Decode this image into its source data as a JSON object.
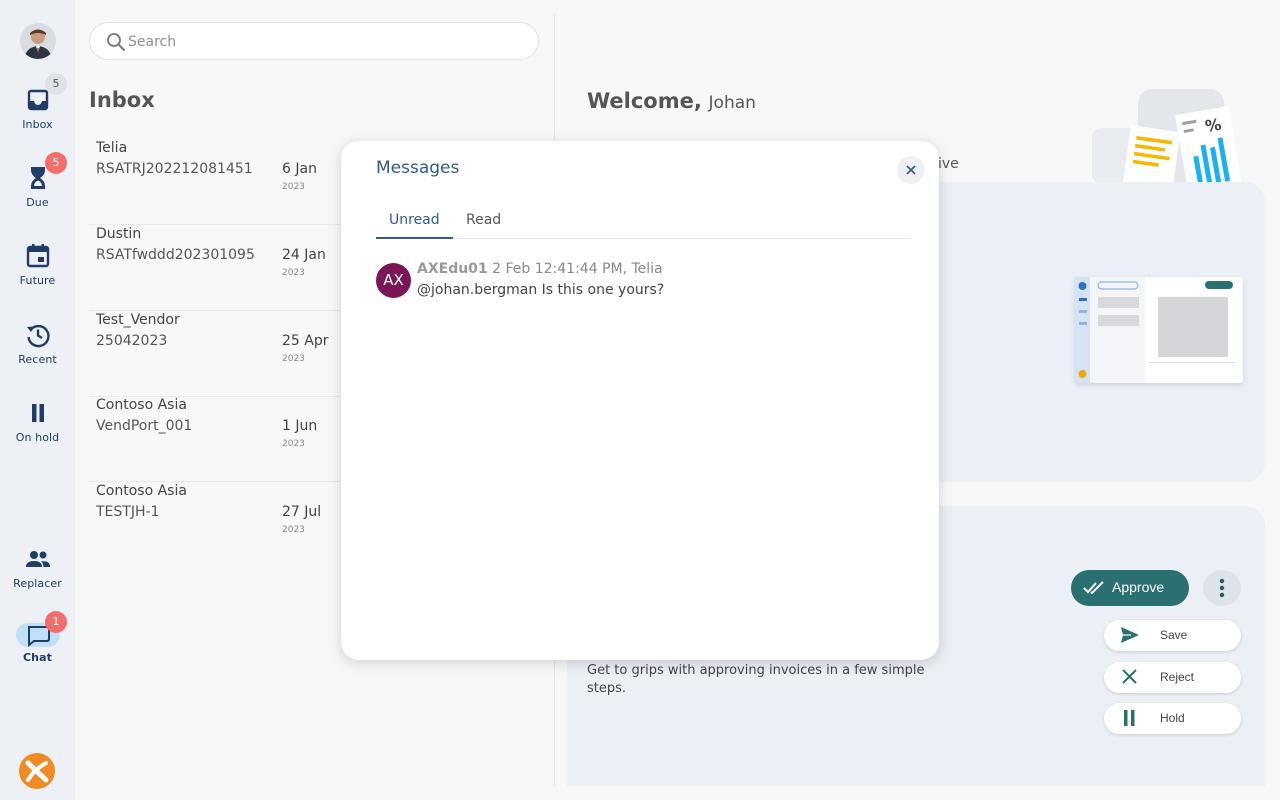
{
  "sidebar": {
    "inbox": {
      "label": "Inbox",
      "badge": "5"
    },
    "due": {
      "label": "Due",
      "badge": "5"
    },
    "future": {
      "label": "Future"
    },
    "recent": {
      "label": "Recent"
    },
    "on_hold": {
      "label": "On hold"
    },
    "replacer": {
      "label": "Replacer"
    },
    "chat": {
      "label": "Chat",
      "badge": "1"
    }
  },
  "search": {
    "placeholder": "Search"
  },
  "inbox": {
    "title": "Inbox",
    "items": [
      {
        "vendor": "Telia",
        "ref": "RSATRJ202212081451",
        "date": "6 Jan",
        "year": "2023"
      },
      {
        "vendor": "Dustin",
        "ref": "RSATfwddd202301095",
        "date": "24 Jan",
        "year": "2023"
      },
      {
        "vendor": "Test_Vendor",
        "ref": "25042023",
        "date": "25 Apr",
        "year": "2023"
      },
      {
        "vendor": "Contoso Asia",
        "ref": "VendPort_001",
        "date": "1 Jun",
        "year": "2023"
      },
      {
        "vendor": "Contoso Asia",
        "ref": "TESTJH-1",
        "date": "27 Jul",
        "year": "2023"
      }
    ]
  },
  "welcome": {
    "greeting": "Welcome,",
    "name": "Johan",
    "sub_fragment": "ive"
  },
  "actions": {
    "approve": "Approve",
    "save": "Save",
    "reject": "Reject",
    "hold": "Hold"
  },
  "guide": {
    "text": "Get to grips with approving invoices in a few simple steps."
  },
  "modal": {
    "title": "Messages",
    "tabs": {
      "unread": "Unread",
      "read": "Read"
    },
    "message": {
      "initials": "AX",
      "author": "AXEdu01",
      "meta": "2 Feb 12:41:44 PM, Telia",
      "body": "@johan.bergman Is this one yours?"
    }
  },
  "colors": {
    "primary": "#2f5b91",
    "approve": "#2a7070",
    "badge_red": "#f46d6d",
    "avatar": "#7b1656",
    "sidebar": "#edf1f6"
  },
  "icons": [
    "inbox-icon",
    "hourglass-icon",
    "calendar-icon",
    "history-icon",
    "pause-icon",
    "people-icon",
    "chat-icon",
    "search-icon",
    "close-icon",
    "double-check-icon",
    "more-vertical-icon",
    "send-icon",
    "x-icon"
  ]
}
